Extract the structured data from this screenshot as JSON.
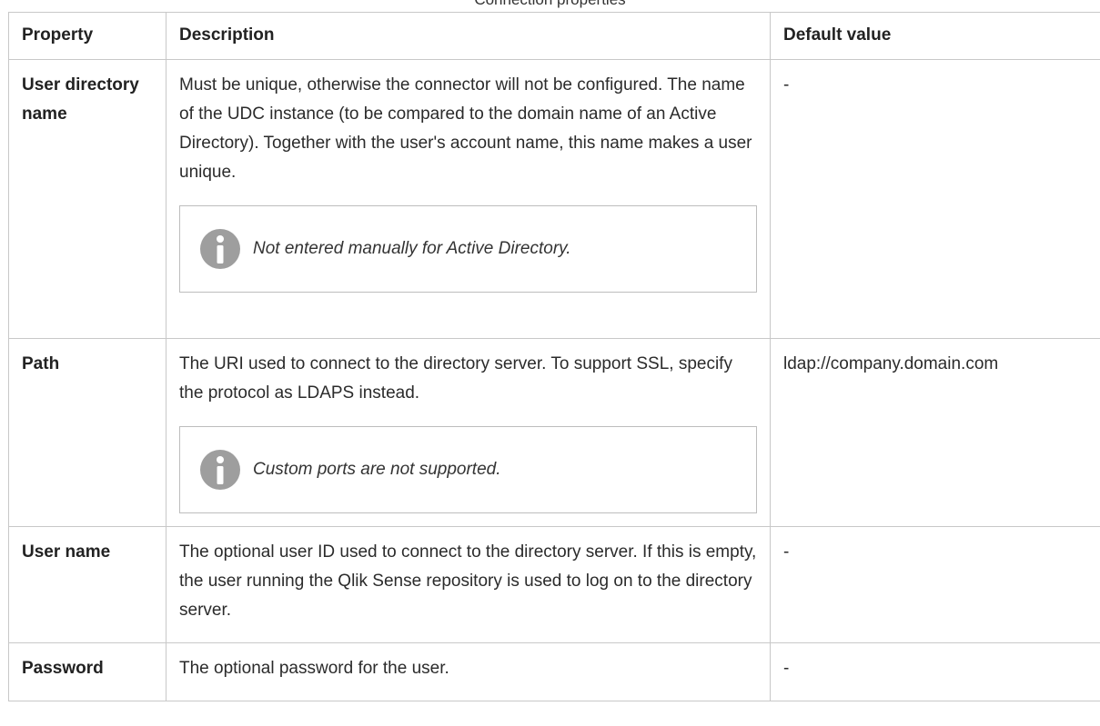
{
  "caption": "Connection properties",
  "table": {
    "headers": [
      "Property",
      "Description",
      "Default value"
    ],
    "rows": [
      {
        "property": "User directory name",
        "description": "Must be unique, otherwise the connector will not be configured. The name of the UDC instance (to be compared to the domain name of an Active Directory). Together with the user's account name, this name makes a user unique.",
        "note": "Not entered manually for Active Directory.",
        "default": "-"
      },
      {
        "property": "Path",
        "description": "The URI used to connect to the directory server. To support SSL, specify the protocol as LDAPS instead.",
        "note": "Custom ports are not supported.",
        "default": "ldap://company.domain.com"
      },
      {
        "property": "User name",
        "description": "The optional user ID used to connect to the directory server. If this is empty, the user running the Qlik Sense repository is used to log on to the directory server.",
        "default": "-"
      },
      {
        "property": "Password",
        "description": "The optional password for the user.",
        "default": "-"
      }
    ]
  },
  "icons": {
    "note_icon": "info-icon"
  },
  "colors": {
    "border": "#c8c8c8",
    "info_icon": "#9e9e9e",
    "text": "#2b2b2b"
  }
}
